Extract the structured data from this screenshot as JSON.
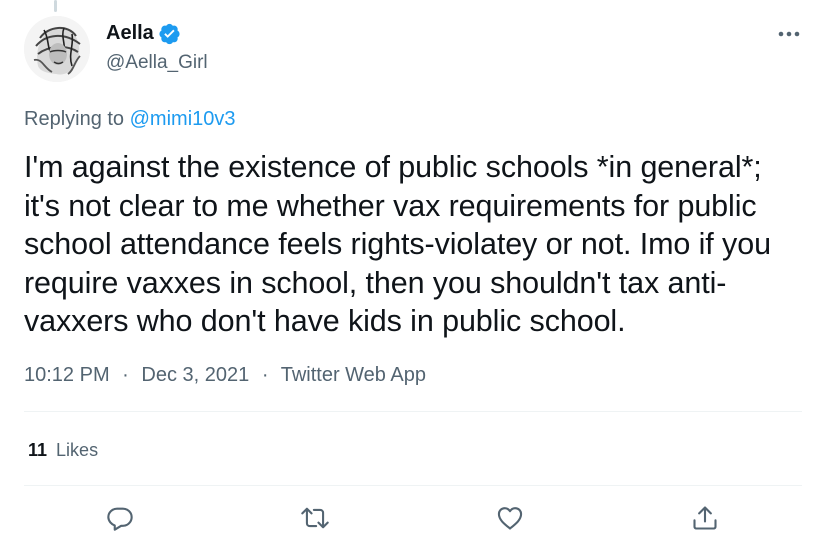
{
  "author": {
    "display_name": "Aella",
    "handle": "@Aella_Girl",
    "verified": true
  },
  "reply": {
    "prefix": "Replying to",
    "mention": "@mimi10v3"
  },
  "tweet": {
    "text": "I'm against the existence of public schools *in general*; it's not clear to me whether vax requirements for public school attendance feels rights-violatey or not. Imo if you require vaxxes in school, then you shouldn't tax anti-vaxxers who don't have kids in public school."
  },
  "meta": {
    "time": "10:12 PM",
    "separator": "·",
    "date": "Dec 3, 2021",
    "source": "Twitter Web App"
  },
  "stats": {
    "likes_count": "11",
    "likes_label": "Likes"
  },
  "icons": {
    "more": "more-icon",
    "reply": "reply-icon",
    "retweet": "retweet-icon",
    "like": "heart-icon",
    "share": "share-icon",
    "verified": "verified-badge-icon"
  },
  "colors": {
    "accent": "#1d9bf0",
    "text_primary": "#0f1419",
    "text_secondary": "#536471",
    "divider": "#eff3f4"
  }
}
